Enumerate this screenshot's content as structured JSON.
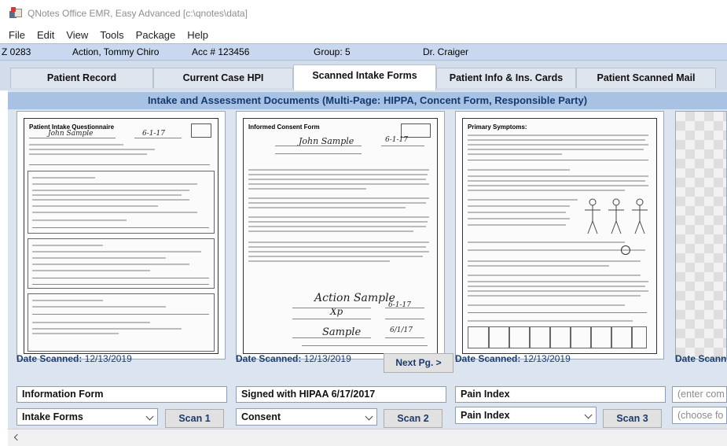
{
  "window": {
    "title": "QNotes Office EMR, Easy Advanced [c:\\qnotes\\data]"
  },
  "menu": [
    "File",
    "Edit",
    "View",
    "Tools",
    "Package",
    "Help"
  ],
  "patient": {
    "id": "Z 0283",
    "name": "Action, Tommy Chiro",
    "account": "Acc # 123456",
    "group": "Group: 5",
    "doctor": "Dr. Craiger"
  },
  "tabs": [
    {
      "label": "Patient Record",
      "active": false
    },
    {
      "label": "Current Case HPI",
      "active": false
    },
    {
      "label": "Scanned Intake Forms",
      "active": true
    },
    {
      "label": "Patient Info & Ins. Cards",
      "active": false
    },
    {
      "label": "Patient Scanned Mail",
      "active": false
    }
  ],
  "banner": "Intake and Assessment Documents (Multi-Page: HIPPA, Concent Form, Responsible Party)",
  "documents": [
    {
      "page_title": "Patient Intake Questionnaire",
      "date_label": "Date Scanned:",
      "date_value": "12/13/2019",
      "description": "Information Form",
      "category": "Intake Forms",
      "scan_label": "Scan 1"
    },
    {
      "page_title": "Informed Consent Form",
      "date_label": "Date Scanned:",
      "date_value": "12/13/2019",
      "description": "Signed with HIPAA 6/17/2017",
      "category": "Consent",
      "scan_label": "Scan 2"
    },
    {
      "page_title": "Primary Symptoms:",
      "date_label": "Date Scanned:",
      "date_value": "12/13/2019",
      "description": "Pain Index",
      "category": "Pain Index",
      "scan_label": "Scan 3"
    },
    {
      "date_label": "Date Scann",
      "description_placeholder": "(enter com",
      "category_placeholder": "(choose fo"
    }
  ],
  "next_page_label": "Next Pg. >",
  "colors": {
    "tab_strip": "#d3dcea",
    "banner": "#a8c2e4",
    "banner_text": "#143a72",
    "patient_bar": "#c9d8ee"
  }
}
